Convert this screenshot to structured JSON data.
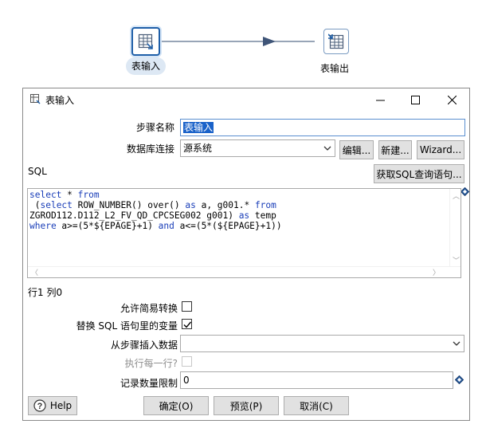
{
  "canvas": {
    "steps": [
      {
        "label": "表输入",
        "icon": "table-input-icon"
      },
      {
        "label": "表输出",
        "icon": "table-output-icon"
      }
    ]
  },
  "dialog": {
    "title": "表输入",
    "step_name_label": "步骤名称",
    "step_name_value": "表输入",
    "db_conn_label": "数据库连接",
    "db_conn_value": "源系统",
    "edit_button": "编辑...",
    "new_button": "新建...",
    "wizard_button": "Wizard...",
    "sql_label": "SQL",
    "get_sql_button": "获取SQL查询语句...",
    "sql_lines": [
      [
        {
          "t": "select",
          "k": true
        },
        {
          "t": " * ",
          "k": false
        },
        {
          "t": "from",
          "k": true
        }
      ],
      [
        {
          "t": " (",
          "k": false
        },
        {
          "t": "select",
          "k": true
        },
        {
          "t": " ROW_NUMBER() over() ",
          "k": false
        },
        {
          "t": "as",
          "k": true
        },
        {
          "t": " a, g001.* ",
          "k": false
        },
        {
          "t": "from",
          "k": true
        }
      ],
      [
        {
          "t": "ZGROD112.D112_L2_FV_QD_CPCSEG002 g001) ",
          "k": false
        },
        {
          "t": "as",
          "k": true
        },
        {
          "t": " temp",
          "k": false
        }
      ],
      [
        {
          "t": "where",
          "k": true
        },
        {
          "t": " a>=(5*${EPAGE}+1) ",
          "k": false
        },
        {
          "t": "and",
          "k": true
        },
        {
          "t": " a<=(5*(${EPAGE}+1))",
          "k": false
        }
      ]
    ],
    "cursor_pos": "行1 列0",
    "lazy_conversion_label": "允许简易转换",
    "lazy_conversion_checked": false,
    "replace_vars_label": "替换 SQL 语句里的变量",
    "replace_vars_checked": true,
    "insert_from_step_label": "从步骤插入数据",
    "insert_from_step_value": "",
    "execute_each_row_label": "执行每一行?",
    "execute_each_row_checked": false,
    "limit_label": "记录数量限制",
    "limit_value": "0",
    "help_button": "Help",
    "ok_button": "确定(O)",
    "preview_button": "预览(P)",
    "cancel_button": "取消(C)"
  },
  "colors": {
    "accent": "#1f5fa8",
    "keyword": "#1a3eb8",
    "selection": "#1a62c9"
  }
}
